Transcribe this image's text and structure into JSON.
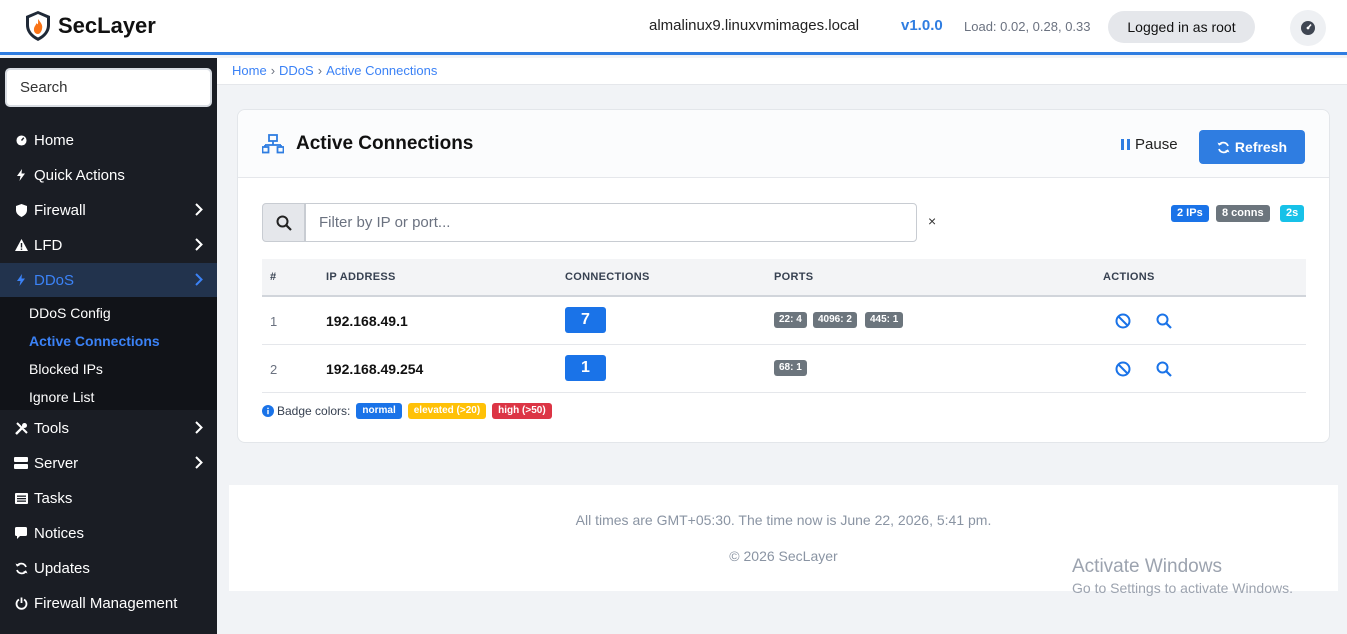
{
  "brand": {
    "name": "SecLayer"
  },
  "header": {
    "hostname": "almalinux9.linuxvmimages.local",
    "version": "v1.0.0",
    "load": "Load: 0.02, 0.28, 0.33",
    "user_badge": "Logged in as root"
  },
  "sidebar": {
    "search_placeholder": "Search",
    "items": [
      {
        "label": "Home",
        "icon": "dashboard-icon"
      },
      {
        "label": "Quick Actions",
        "icon": "bolt-icon"
      },
      {
        "label": "Firewall",
        "icon": "shield-icon"
      },
      {
        "label": "LFD",
        "icon": "warning-icon"
      },
      {
        "label": "DDoS",
        "icon": "bolt-icon"
      },
      {
        "label": "Tools",
        "icon": "tools-icon"
      },
      {
        "label": "Server",
        "icon": "server-icon"
      },
      {
        "label": "Tasks",
        "icon": "list-icon"
      },
      {
        "label": "Notices",
        "icon": "comment-icon"
      },
      {
        "label": "Updates",
        "icon": "sync-icon"
      },
      {
        "label": "Firewall Management",
        "icon": "power-icon"
      }
    ],
    "ddos_sub": [
      "DDoS Config",
      "Active Connections",
      "Blocked IPs",
      "Ignore List"
    ]
  },
  "breadcrumb": [
    "Home",
    "DDoS",
    "Active Connections"
  ],
  "card": {
    "title": "Active Connections",
    "pause_label": "Pause",
    "refresh_label": "Refresh",
    "filter_placeholder": "Filter by IP or port...",
    "clear_label": "×",
    "stats": {
      "ips": "2 IPs",
      "conns": "8 conns",
      "interval": "2s"
    },
    "columns": [
      "#",
      "IP ADDRESS",
      "CONNECTIONS",
      "PORTS",
      "ACTIONS"
    ],
    "rows": [
      {
        "num": "1",
        "ip": "192.168.49.1",
        "connections": "7",
        "ports": [
          "22: 4",
          "4096: 2",
          "445: 1"
        ]
      },
      {
        "num": "2",
        "ip": "192.168.49.254",
        "connections": "1",
        "ports": [
          "68: 1"
        ]
      }
    ],
    "legend": {
      "label": "Badge colors:",
      "normal": "normal",
      "elevated": "elevated (>20)",
      "high": "high (>50)"
    }
  },
  "footer": {
    "time": "All times are GMT+05:30. The time now is June 22, 2026, 5:41 pm.",
    "copyright": "© 2026 SecLayer"
  },
  "watermark": {
    "line1": "Activate Windows",
    "line2": "Go to Settings to activate Windows."
  },
  "colors": {
    "accent": "#2f7de1",
    "sidebar": "#1a1d24",
    "elevated": "#ffc107",
    "high": "#dc3545",
    "info": "#17c1e8"
  }
}
